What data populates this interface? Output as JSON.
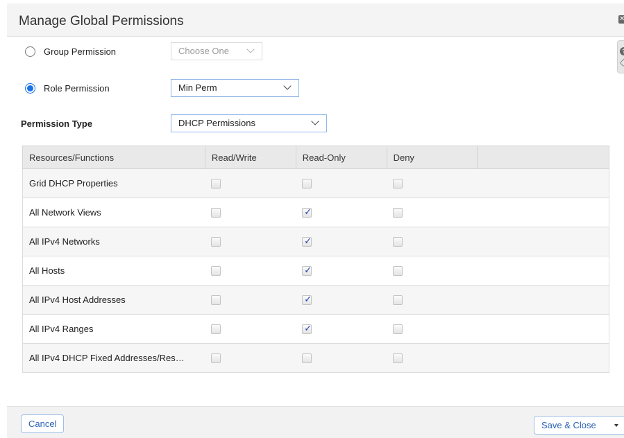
{
  "dialog": {
    "title": "Manage Global Permissions",
    "close_icon_text": "✕"
  },
  "help": {
    "icon_text": "?"
  },
  "form": {
    "group_permission": {
      "label": "Group Permission",
      "selected": false,
      "select_value": "Choose One",
      "disabled": true
    },
    "role_permission": {
      "label": "Role Permission",
      "selected": true,
      "select_value": "Min Perm"
    },
    "permission_type": {
      "label": "Permission Type",
      "select_value": "DHCP Permissions"
    }
  },
  "table": {
    "columns": [
      "Resources/Functions",
      "Read/Write",
      "Read-Only",
      "Deny",
      ""
    ],
    "rows": [
      {
        "name": "Grid DHCP Properties",
        "read_write": false,
        "read_only": false,
        "deny": false
      },
      {
        "name": "All Network Views",
        "read_write": false,
        "read_only": true,
        "deny": false
      },
      {
        "name": "All IPv4 Networks",
        "read_write": false,
        "read_only": true,
        "deny": false
      },
      {
        "name": "All Hosts",
        "read_write": false,
        "read_only": true,
        "deny": false
      },
      {
        "name": "All IPv4 Host Addresses",
        "read_write": false,
        "read_only": true,
        "deny": false
      },
      {
        "name": "All IPv4 Ranges",
        "read_write": false,
        "read_only": true,
        "deny": false
      },
      {
        "name": "All IPv4 DHCP Fixed Addresses/Res…",
        "read_write": false,
        "read_only": false,
        "deny": false
      }
    ]
  },
  "footer": {
    "cancel_label": "Cancel",
    "save_label": "Save & Close"
  },
  "colors": {
    "accent": "#1a73e8",
    "button_text": "#2b61b5"
  }
}
